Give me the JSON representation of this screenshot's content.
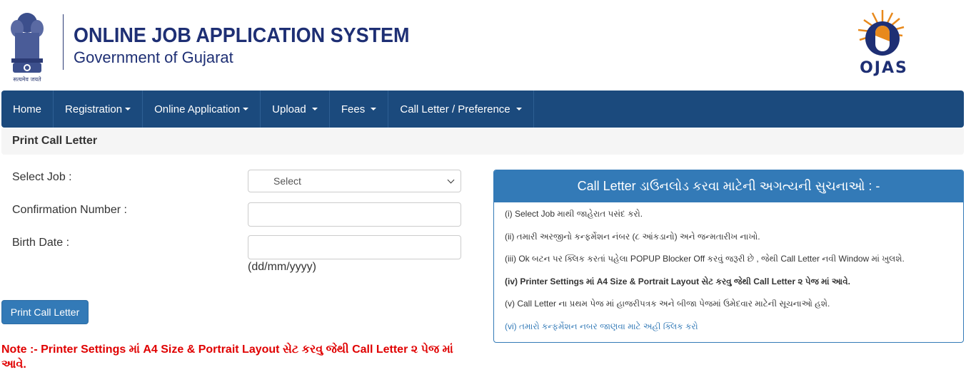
{
  "header": {
    "emblem_caption": "सत्यमेव जयते",
    "title": "ONLINE JOB APPLICATION SYSTEM",
    "subtitle": "Government of Gujarat",
    "logo_text": "OJAS"
  },
  "nav": {
    "items": [
      {
        "label": "Home",
        "dropdown": false
      },
      {
        "label": "Registration",
        "dropdown": true
      },
      {
        "label": "Online Application",
        "dropdown": true
      },
      {
        "label": "Upload",
        "dropdown": true
      },
      {
        "label": "Fees",
        "dropdown": true
      },
      {
        "label": "Call Letter / Preference",
        "dropdown": true
      }
    ]
  },
  "page": {
    "heading": "Print Call Letter"
  },
  "form": {
    "select_job_label": "Select Job :",
    "select_job_value": "Select",
    "confirmation_label": "Confirmation Number :",
    "confirmation_value": "",
    "birth_date_label": "Birth Date :",
    "birth_date_value": "",
    "birth_date_hint": "(dd/mm/yyyy)",
    "submit_label": "Print Call Letter"
  },
  "note": "Note :- Printer Settings માં A4 Size & Portrait Layout સેટ કરવુ જેથી Call Letter ૨ પેજ માં આવે.",
  "instructions": {
    "title": "Call Letter ડાઉનલોડ કરવા માટેની અગત્યની સુચનાઓ : -",
    "items": [
      "(i) Select Job માથી જાહેરાત પસંદ કરો.",
      "(ii) તમારી અરજીનો કન્ફર્મેશન નંબર (૮ આંકડાનો) અને જન્મતારીખ નાખો.",
      "(iii) Ok બટન પર ક્લિક કરતાં પહેલા POPUP Blocker Off કરવું જરૂરી છે , જેથી Call Letter નવી Window માં ખુલશે.",
      "(iv) Printer Settings માં A4 Size & Portrait Layout સેટ કરવુ જેથી Call Letter ૨ પેજ માં આવે.",
      "(v) Call Letter ના પ્રથમ પેજ માં હાજરીપત્રક અને બીજા પેજમાં ઉમેદવાર માટેની સૂચનાઓ હશે.",
      "(vi) તમારો કન્ફર્મેશન નબર જાણવા માટે અહી ક્લિક કરો"
    ]
  },
  "colors": {
    "nav_bg": "#1b4a7d",
    "primary": "#337ab7",
    "title_blue": "#1e2f74",
    "note_red": "#e00000",
    "logo_orange": "#e8891c"
  }
}
